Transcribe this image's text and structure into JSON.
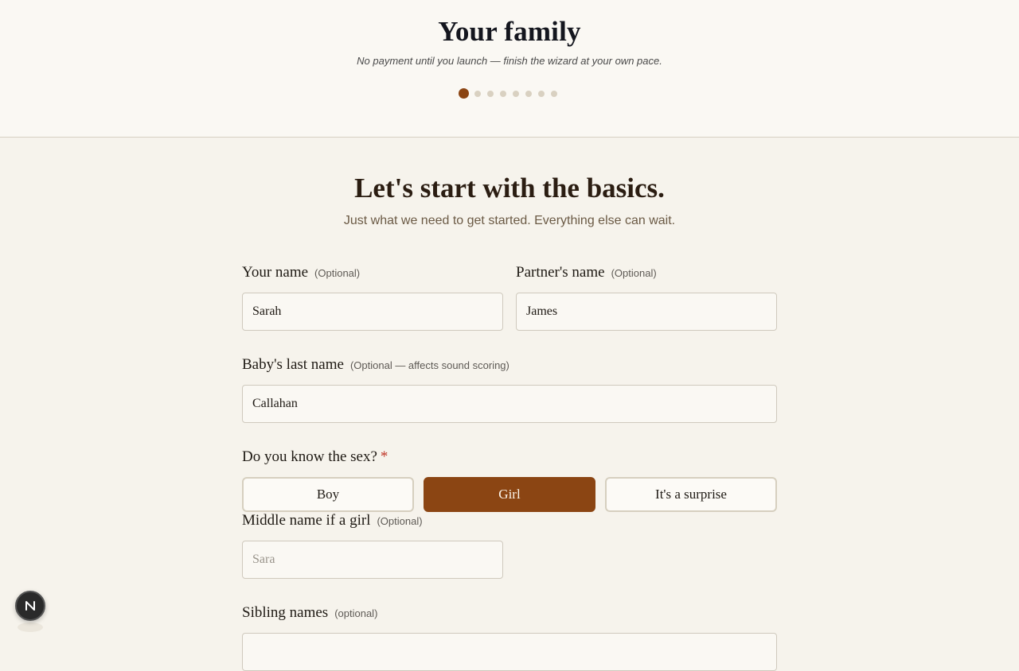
{
  "header": {
    "title": "Your family",
    "subtitle": "No payment until you launch — finish the wizard at your own pace.",
    "steps_total": 8,
    "current_step": 1
  },
  "main": {
    "headline": "Let's start with the basics.",
    "subline": "Just what we need to get started. Everything else can wait."
  },
  "fields": {
    "your_name": {
      "label": "Your name",
      "hint": "(Optional)",
      "value": "Sarah"
    },
    "partner_name": {
      "label": "Partner's name",
      "hint": "(Optional)",
      "value": "James"
    },
    "last_name": {
      "label": "Baby's last name",
      "hint": "(Optional — affects sound scoring)",
      "value": "Callahan"
    },
    "sex": {
      "label": "Do you know the sex?",
      "required_mark": "*",
      "options": [
        "Boy",
        "Girl",
        "It's a surprise"
      ],
      "selected": "Girl"
    },
    "middle_name": {
      "label": "Middle name if a girl",
      "hint": "(Optional)",
      "value": "",
      "placeholder": "Sara"
    },
    "siblings": {
      "label": "Sibling names",
      "hint": "(optional)"
    }
  },
  "fab": {
    "icon": "n-logo-icon",
    "letter": "N"
  },
  "colors": {
    "accent": "#8b4513",
    "background": "#f6f3ec",
    "header_bg": "#faf8f3"
  }
}
